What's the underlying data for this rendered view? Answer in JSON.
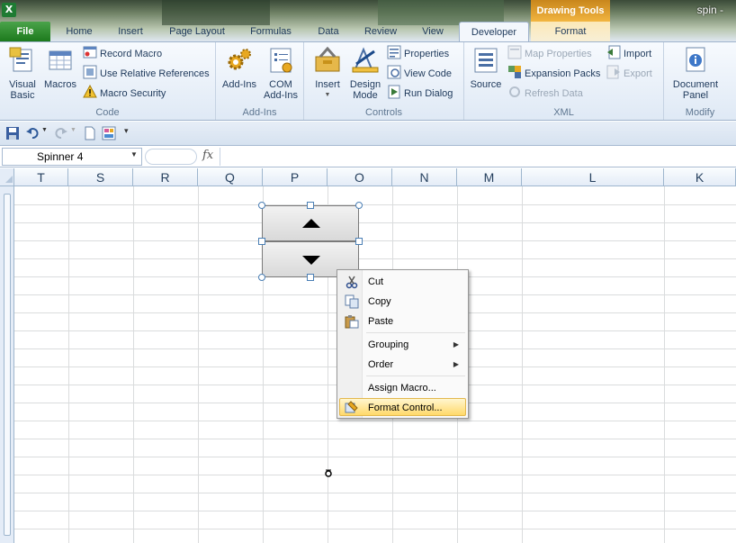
{
  "window": {
    "title": "spin  -",
    "app_icon": "X"
  },
  "context_tab_group": "Drawing Tools",
  "tabs": [
    {
      "label": "File"
    },
    {
      "label": "Home"
    },
    {
      "label": "Insert"
    },
    {
      "label": "Page Layout"
    },
    {
      "label": "Formulas"
    },
    {
      "label": "Data"
    },
    {
      "label": "Review"
    },
    {
      "label": "View"
    },
    {
      "label": "Developer"
    },
    {
      "label": "Format"
    }
  ],
  "ribbon": {
    "code": {
      "label": "Code",
      "visual_basic": "Visual\nBasic",
      "macros": "Macros",
      "record_macro": "Record Macro",
      "relative_refs": "Use Relative References",
      "macro_security": "Macro Security"
    },
    "addins": {
      "label": "Add-Ins",
      "addins": "Add-Ins",
      "com_addins": "COM\nAdd-Ins"
    },
    "controls": {
      "label": "Controls",
      "insert": "Insert",
      "design_mode": "Design\nMode",
      "properties": "Properties",
      "view_code": "View Code",
      "run_dialog": "Run Dialog"
    },
    "xml": {
      "label": "XML",
      "source": "Source",
      "map_properties": "Map Properties",
      "expansion_packs": "Expansion Packs",
      "refresh_data": "Refresh Data",
      "import": "Import",
      "export": "Export"
    },
    "modify": {
      "label": "Modify",
      "document_panel": "Document\nPanel"
    }
  },
  "formula_bar": {
    "name_box": "Spinner 4",
    "fx": "fx",
    "value": ""
  },
  "columns": [
    "T",
    "S",
    "R",
    "Q",
    "P",
    "O",
    "N",
    "M",
    "L",
    "K"
  ],
  "context_menu": {
    "items": [
      {
        "label": "Cut",
        "icon": "scissors-icon",
        "submenu": false
      },
      {
        "label": "Copy",
        "icon": "copy-icon",
        "submenu": false
      },
      {
        "label": "Paste",
        "icon": "paste-icon",
        "submenu": false
      },
      {
        "label": "Grouping",
        "icon": "",
        "submenu": true
      },
      {
        "label": "Order",
        "icon": "",
        "submenu": true
      },
      {
        "label": "Assign Macro...",
        "icon": "",
        "submenu": false
      },
      {
        "label": "Format Control...",
        "icon": "format-control-icon",
        "submenu": false,
        "highlighted": true
      }
    ]
  },
  "colors": {
    "file_tab": "#2a8a2a",
    "drawing_tools": "#e8a22e",
    "menu_highlight": "#ffd96a",
    "gridline": "#dadcdd"
  }
}
